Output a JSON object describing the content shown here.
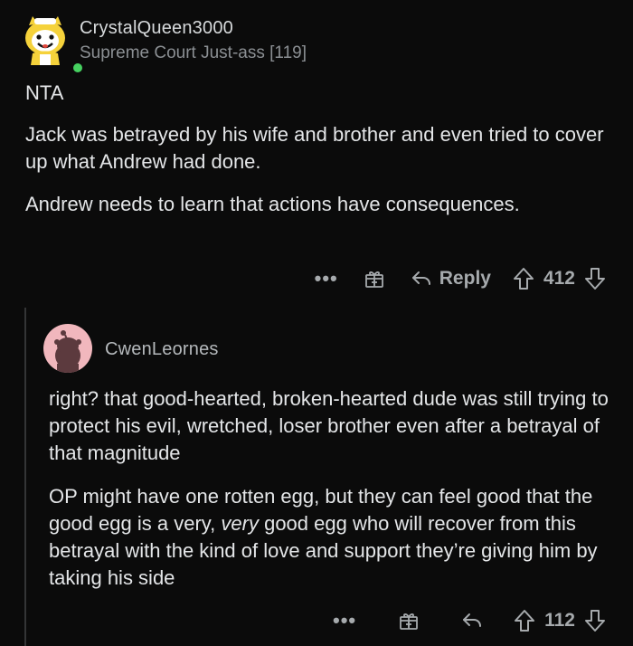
{
  "comment1": {
    "username": "CrystalQueen3000",
    "flair": "Supreme Court Just-ass [119]",
    "paragraphs": [
      "NTA",
      "Jack was betrayed by his wife and brother and even tried to cover up what Andrew had done.",
      "Andrew needs to learn that actions have consequences."
    ],
    "actions": {
      "more": "•••",
      "award_icon": "gift-icon",
      "reply_label": "Reply",
      "votes": "412"
    }
  },
  "comment2": {
    "username": "CwenLeornes",
    "paragraph1": "right? that good-hearted, broken-hearted dude was still trying to protect his evil, wretched, loser brother even after a betrayal of that magnitude",
    "paragraph2_before": "OP might have one rotten egg, but they can feel good that the good egg is a very,",
    "paragraph2_em": "very",
    "paragraph2_after": "good egg who will recover from this betrayal with the kind of love and support they’re giving him by taking his side",
    "actions": {
      "more": "•••",
      "votes": "112"
    }
  },
  "colors": {
    "background": "#0b0b0b",
    "online": "#46d160",
    "snoo_avatar_bg": "#f1b7bd"
  }
}
